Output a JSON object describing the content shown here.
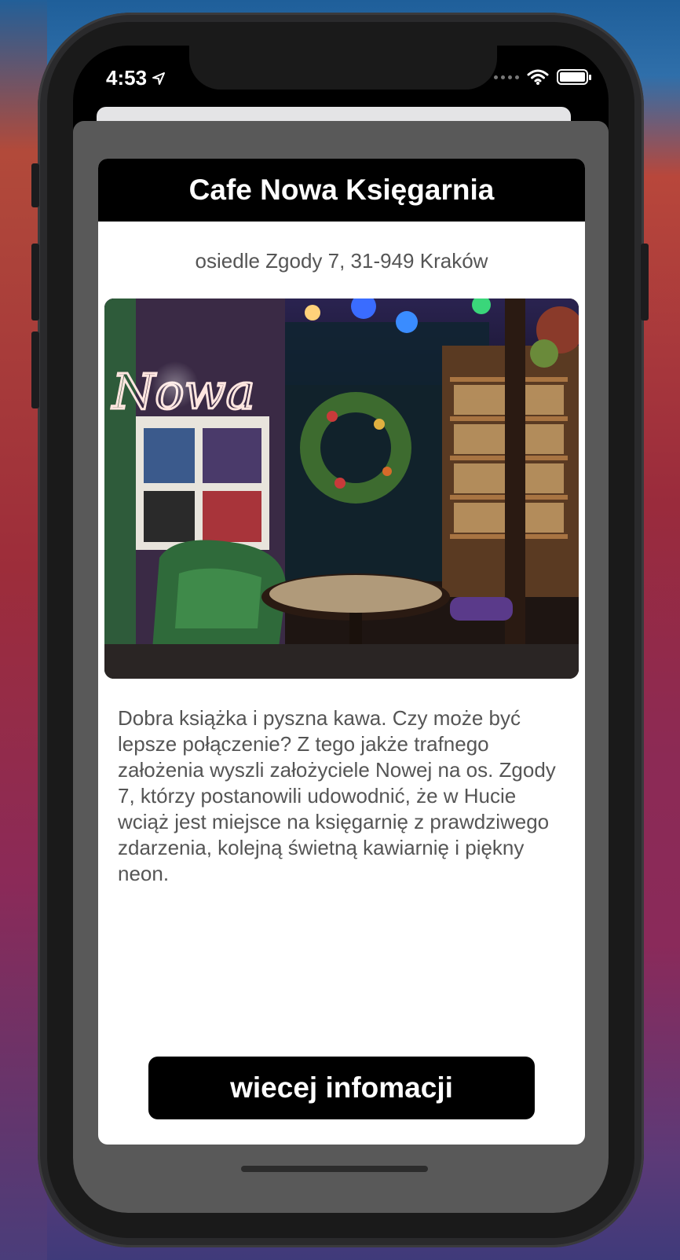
{
  "status_bar": {
    "time": "4:53"
  },
  "card": {
    "title": "Cafe Nowa Księgarnia",
    "address": "osiedle Zgody 7, 31-949 Kraków",
    "photo_icon": "cafe-interior-photo",
    "description": "Dobra książka i pyszna kawa. Czy może być lepsze połączenie? Z tego jakże trafnego założenia wyszli założyciele Nowej na os. Zgody 7, którzy postanowili udowodnić, że w Hucie wciąż jest miejsce na księgarnię z prawdziwego zdarzenia, kolejną świetną kawiarnię i piękny neon.",
    "button_label": "wiecej infomacji"
  },
  "colors": {
    "header_bg": "#000000",
    "sheet_bg": "#595959",
    "card_bg": "#ffffff",
    "text_gray": "#555555"
  }
}
